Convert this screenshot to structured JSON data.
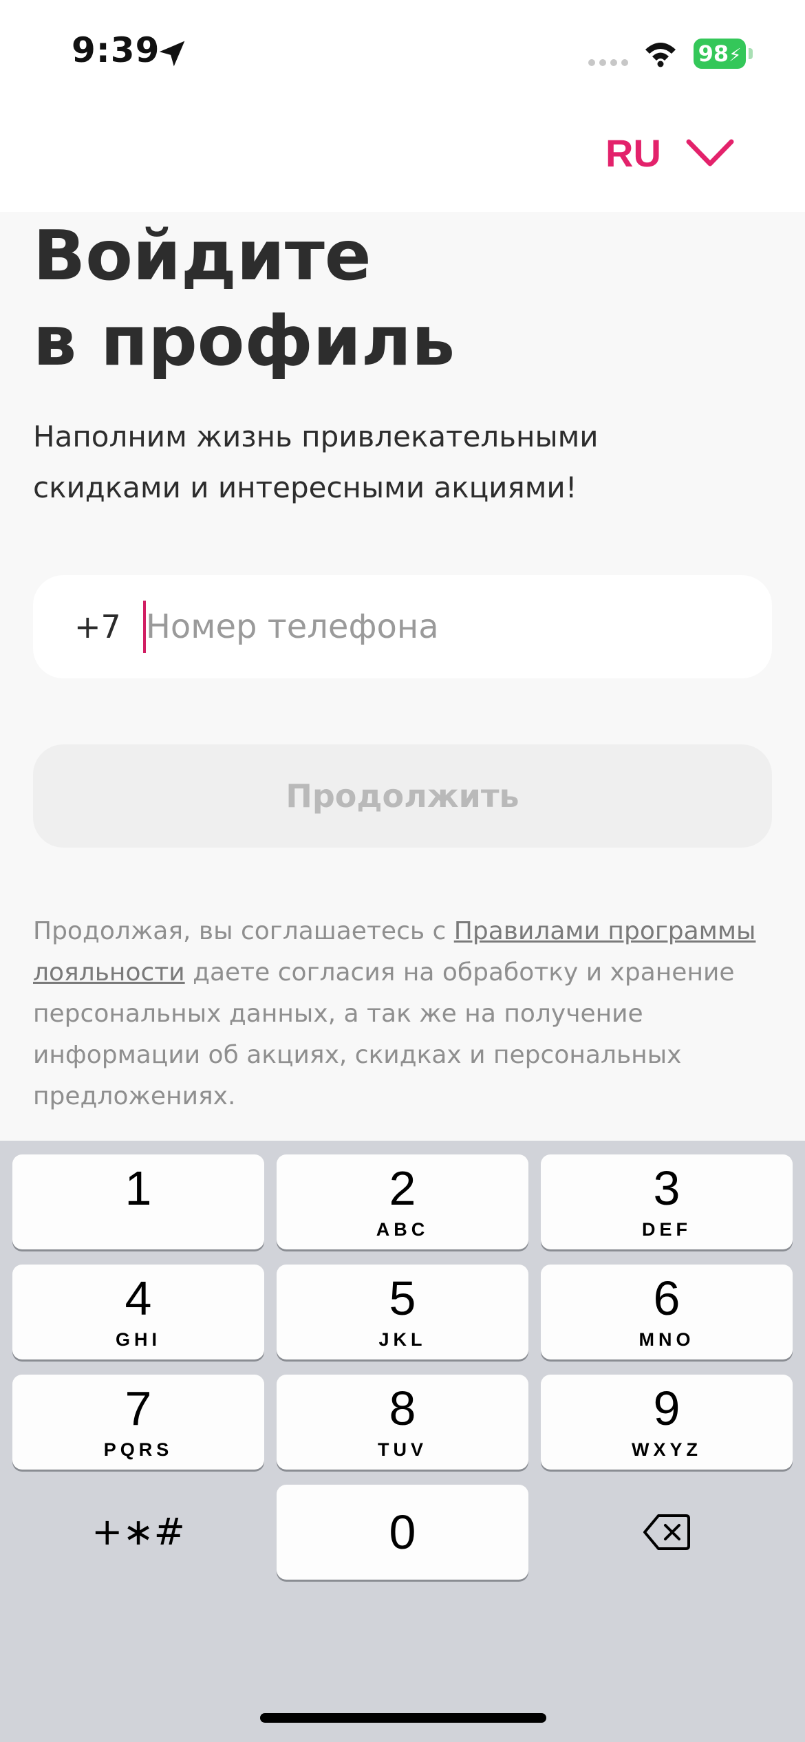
{
  "status_bar": {
    "time": "9:39",
    "battery": "98",
    "battery_color": "#34c759"
  },
  "header": {
    "language": "RU",
    "accent_color": "#e3226b",
    "chevron_icon": "chevron-down-icon"
  },
  "main": {
    "title_line1": "Войдите",
    "title_line2": "в профиль",
    "subtitle_line1": "Наполним жизнь привлекательными",
    "subtitle_line2": "скидками и интересными акциями!",
    "phone_prefix": "+7",
    "phone_placeholder": "Номер телефона",
    "continue_label": "Продолжить",
    "legal": {
      "text_before": "Продолжая, вы соглашаетесь с ",
      "link_text": "Правилами программы лояльности",
      "text_after": " даете согласия на обработку и хранение персональных данных, а так же на получение информации об акциях, скидках и персональных предложениях."
    }
  },
  "keyboard": {
    "keys": [
      {
        "digit": "1",
        "letters": ""
      },
      {
        "digit": "2",
        "letters": "ABC"
      },
      {
        "digit": "3",
        "letters": "DEF"
      },
      {
        "digit": "4",
        "letters": "GHI"
      },
      {
        "digit": "5",
        "letters": "JKL"
      },
      {
        "digit": "6",
        "letters": "MNO"
      },
      {
        "digit": "7",
        "letters": "PQRS"
      },
      {
        "digit": "8",
        "letters": "TUV"
      },
      {
        "digit": "9",
        "letters": "WXYZ"
      }
    ],
    "zero": "0",
    "symbols": "+∗#",
    "delete_icon": "backspace-icon"
  }
}
